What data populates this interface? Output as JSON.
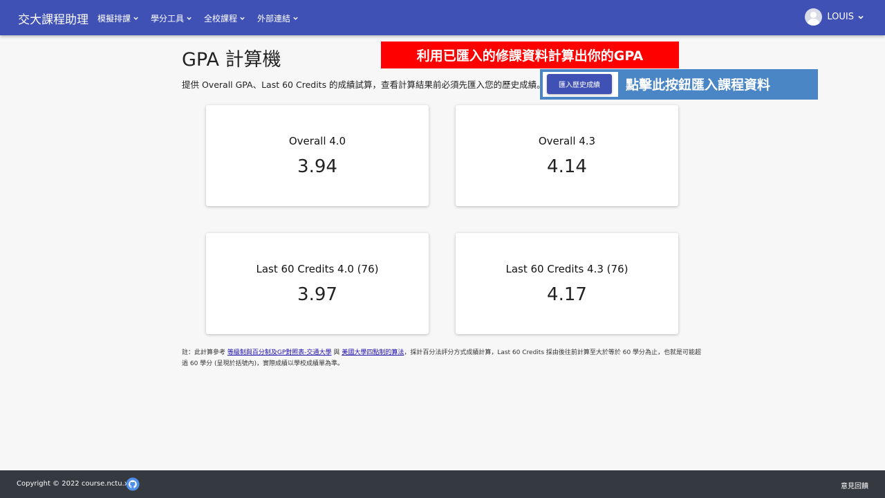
{
  "nav": {
    "brand": "交大課程助理",
    "menu": [
      "模擬排課",
      "學分工具",
      "全校課程",
      "外部連結"
    ],
    "user": "LOUIS"
  },
  "page": {
    "title": "GPA 計算機",
    "description": "提供 Overall GPA、Last 60 Credits 的成績試算，查看計算結果前必須先匯入您的歷史成績。",
    "import_button": "匯入歷史成績"
  },
  "annotations": {
    "red": "利用已匯入的修課資料計算出你的GPA",
    "blue": "點擊此按鈕匯入課程資料"
  },
  "cards": [
    {
      "label": "Overall 4.0",
      "value": "3.94"
    },
    {
      "label": "Overall 4.3",
      "value": "4.14"
    },
    {
      "label": "Last 60 Credits 4.0 (76)",
      "value": "3.97"
    },
    {
      "label": "Last 60 Credits 4.3 (76)",
      "value": "4.17"
    }
  ],
  "note": {
    "prefix": "註：此計算參考",
    "link1": "等級制與百分制及GP對照表-交通大學",
    "mid": "與",
    "link2": "美國大學四點制的算法",
    "suffix": "，採計百分法評分方式成績計算，Last 60 Credits 採由後往前計算至大於等於 60 學分為止，也就是可能超過 60 學分 (呈現於括號內)，實際成績以學校成績單為準。"
  },
  "footer": {
    "copyright": "Copyright © 2022 course.nctu.xyz",
    "github_icon": "github-icon",
    "feedback": "意見回饋"
  },
  "colors": {
    "primary": "#3f51b5",
    "annotation_red": "#ff0000",
    "annotation_blue": "#4a86c6",
    "footer": "#353a40"
  }
}
